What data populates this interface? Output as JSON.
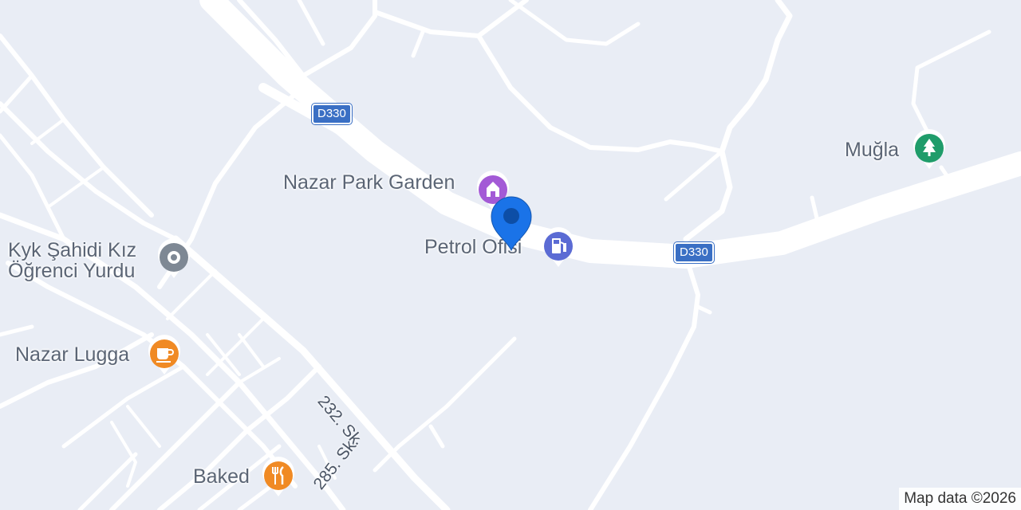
{
  "roads": {
    "highway_label": "D330"
  },
  "streets": {
    "s232": "232. Sk.",
    "s285": "285. Sk."
  },
  "pois": {
    "nazar_park": {
      "label": "Nazar Park Garden",
      "icon": "amusement-park-icon",
      "color": "#a35ad6"
    },
    "petrol": {
      "label": "Petrol Ofisi",
      "icon": "gas-station-icon",
      "color": "#5b6bd4"
    },
    "mugla": {
      "label": "Muğla",
      "icon": "park-tree-icon",
      "color": "#1f9c6a"
    },
    "kyk": {
      "label_line1": "Kyk Şahidi Kız",
      "label_line2": "Öğrenci Yurdu",
      "icon": "building-icon",
      "color": "#7e8894"
    },
    "lugga": {
      "label": "Nazar Lugga",
      "icon": "coffee-cup-icon",
      "color": "#f08a24"
    },
    "baked": {
      "label": "Baked",
      "icon": "fork-knife-icon",
      "color": "#f08a24"
    }
  },
  "location_marker": {
    "icon": "location-pin-icon",
    "color": "#1a73e8"
  },
  "attribution": "Map data ©2026"
}
